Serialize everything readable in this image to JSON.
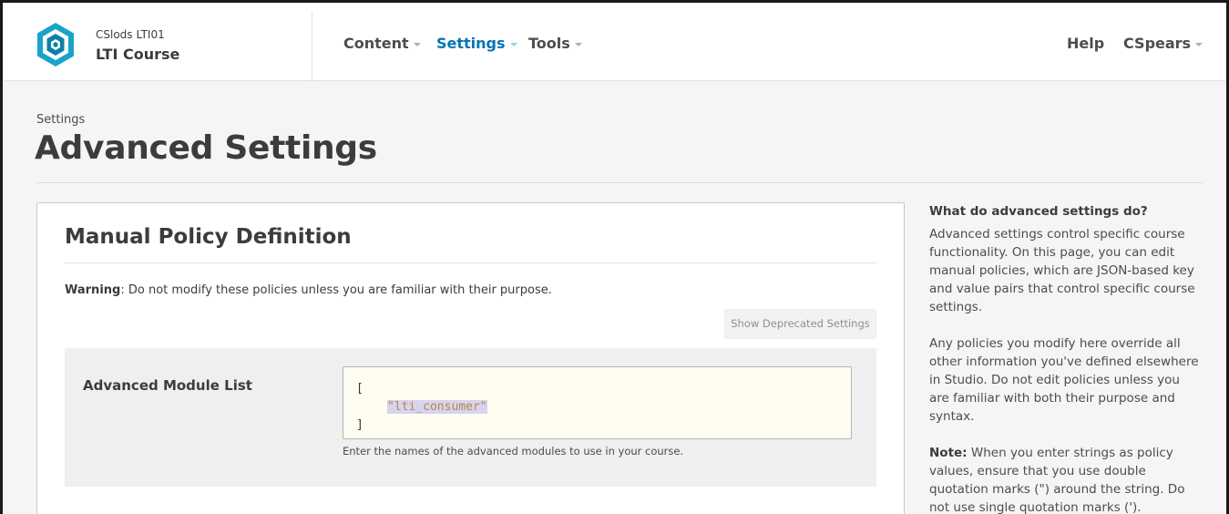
{
  "header": {
    "course_org": "CSlods",
    "course_number": "LTI01",
    "course_name": "LTI Course",
    "nav": {
      "content": "Content",
      "settings": "Settings",
      "tools": "Tools",
      "help": "Help",
      "user": "CSpears"
    },
    "accent_color": "#0075b4"
  },
  "page": {
    "breadcrumb": "Settings",
    "title": "Advanced Settings"
  },
  "policy": {
    "title": "Manual Policy Definition",
    "warning_label": "Warning",
    "warning_text": ": Do not modify these policies unless you are familiar with their purpose.",
    "deprecated_button": "Show Deprecated Settings",
    "setting": {
      "label": "Advanced Module List",
      "json_open": "[",
      "json_value": "\"lti_consumer\"",
      "json_close": "]",
      "help": "Enter the names of the advanced modules to use in your course."
    }
  },
  "sidebar": {
    "heading": "What do advanced settings do?",
    "para1": "Advanced settings control specific course functionality. On this page, you can edit manual policies, which are JSON-based key and value pairs that control specific course settings.",
    "para2": "Any policies you modify here override all other information you've defined elsewhere in Studio. Do not edit policies unless you are familiar with both their purpose and syntax.",
    "note_label": "Note:",
    "note_text": " When you enter strings as policy values, ensure that you use double quotation marks (\") around the string. Do not use single quotation marks (')."
  }
}
